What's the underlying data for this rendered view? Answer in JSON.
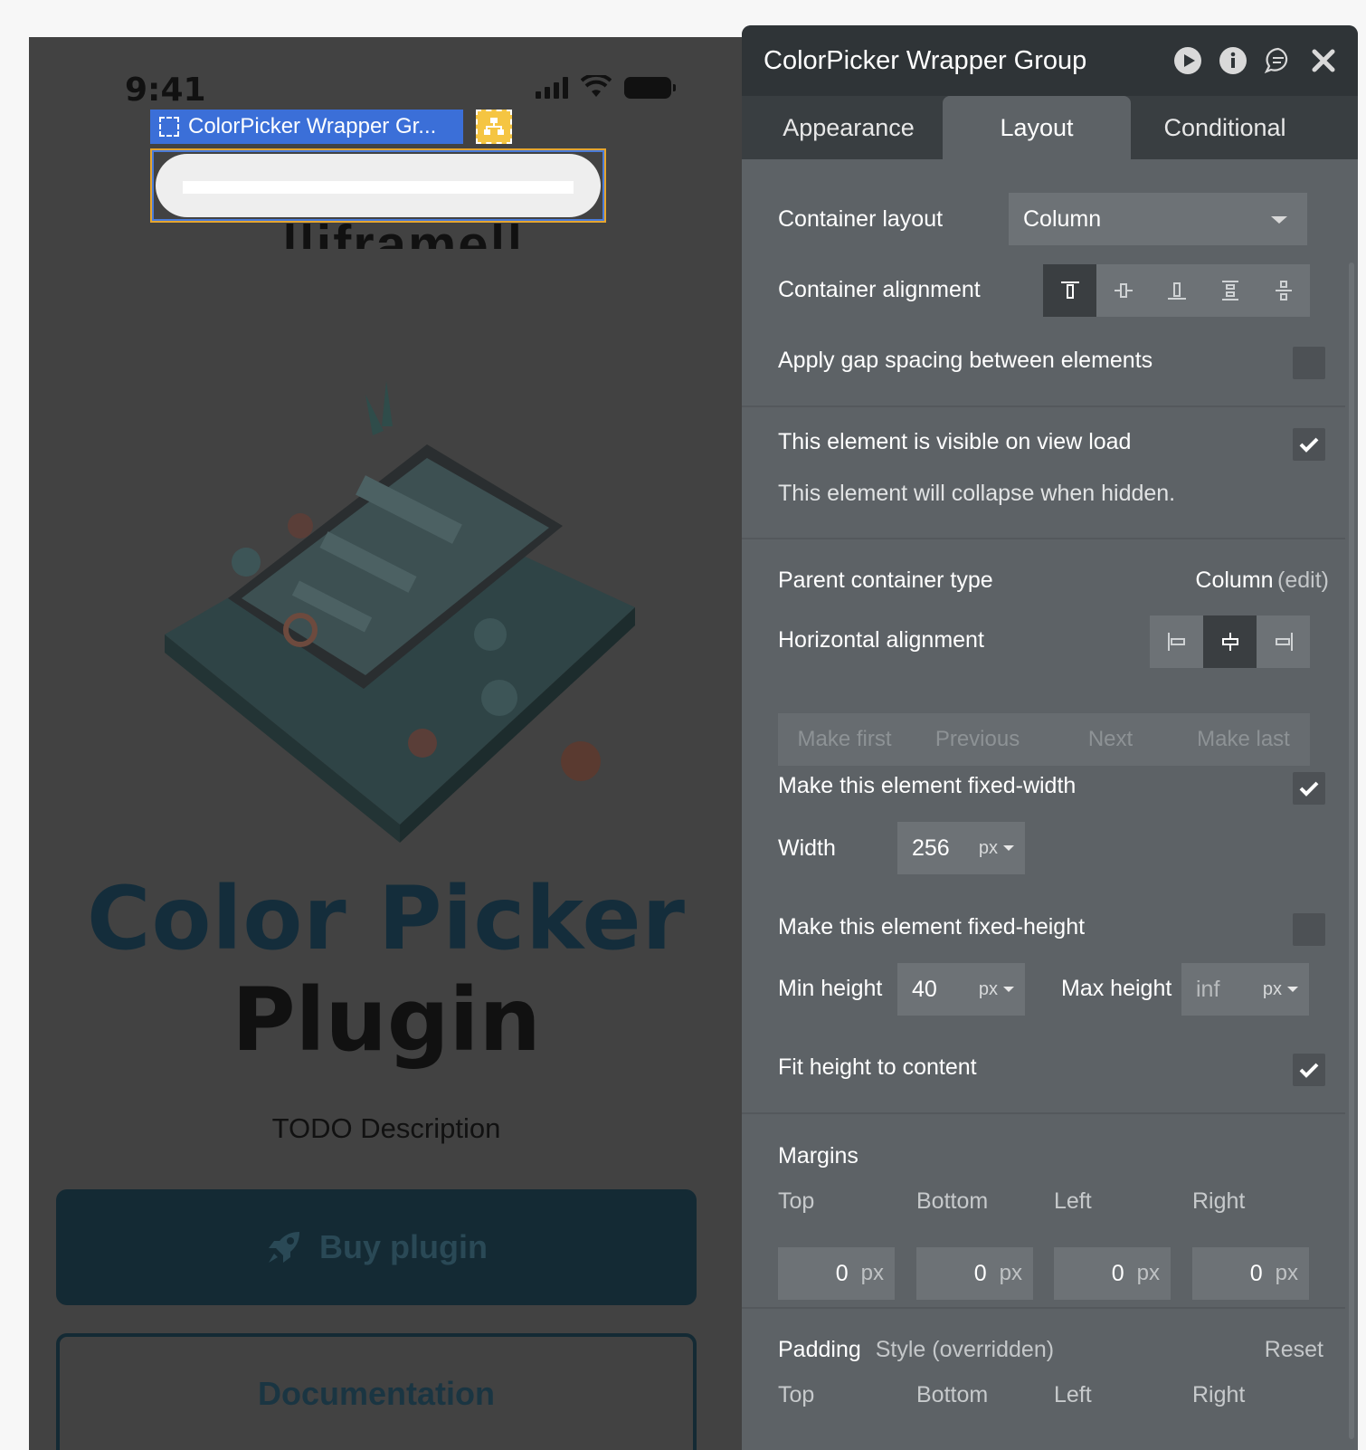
{
  "canvas": {
    "status_time": "9:41",
    "selection_label": "ColorPicker Wrapper Gr...",
    "iframe_text": "||iframe||",
    "hero_title_line1": "Color Picker",
    "hero_title_line2": "Plugin",
    "description": "TODO Description",
    "buy_button": "Buy plugin",
    "documentation_button": "Documentation"
  },
  "panel": {
    "title": "ColorPicker Wrapper Group",
    "header_icons": [
      "play-icon",
      "info-icon",
      "comment-icon",
      "close-icon"
    ],
    "tabs": [
      "Appearance",
      "Layout",
      "Conditional"
    ],
    "active_tab": "Layout",
    "container_layout": {
      "label": "Container layout",
      "value": "Column"
    },
    "container_alignment": {
      "label": "Container alignment",
      "options": [
        "top",
        "center",
        "bottom",
        "space-between",
        "space-around"
      ],
      "selected": "top"
    },
    "gap_spacing": {
      "label": "Apply gap spacing between elements",
      "checked": false
    },
    "visible_on_load": {
      "label": "This element is visible on view load",
      "checked": true
    },
    "collapse_note": "This element will collapse when hidden.",
    "parent_container": {
      "label": "Parent container type",
      "value": "Column",
      "edit": "(edit)"
    },
    "horizontal_alignment": {
      "label": "Horizontal alignment",
      "options": [
        "left",
        "center",
        "right"
      ],
      "selected": "center"
    },
    "reorder": [
      "Make first",
      "Previous",
      "Next",
      "Make last"
    ],
    "fixed_width": {
      "label": "Make this element fixed-width",
      "checked": true
    },
    "width": {
      "label": "Width",
      "value": "256",
      "unit": "px"
    },
    "fixed_height": {
      "label": "Make this element fixed-height",
      "checked": false
    },
    "min_height": {
      "label": "Min height",
      "value": "40",
      "unit": "px"
    },
    "max_height": {
      "label": "Max height",
      "value": "inf",
      "unit": "px"
    },
    "fit_height": {
      "label": "Fit height to content",
      "checked": true
    },
    "margins": {
      "label": "Margins",
      "fields": [
        {
          "name": "Top",
          "value": "0",
          "unit": "px"
        },
        {
          "name": "Bottom",
          "value": "0",
          "unit": "px"
        },
        {
          "name": "Left",
          "value": "0",
          "unit": "px"
        },
        {
          "name": "Right",
          "value": "0",
          "unit": "px"
        }
      ]
    },
    "padding": {
      "label": "Padding",
      "style_note": "Style (overridden)",
      "reset": "Reset",
      "fields": [
        "Top",
        "Bottom",
        "Left",
        "Right"
      ]
    }
  },
  "colors": {
    "panel_bg": "#5d6266",
    "header_bg": "#2f3437",
    "selection_blue": "#3b6fd8",
    "selection_orange": "#e4a530",
    "hero_dark": "#142d3b"
  }
}
